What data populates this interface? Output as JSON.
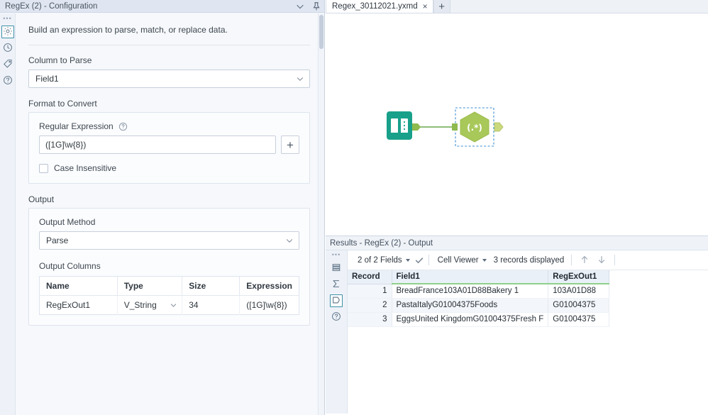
{
  "config_panel": {
    "title": "RegEx (2) - Configuration",
    "titlebar_icons": {
      "collapse": "chevron-down-icon",
      "pin": "pin-icon"
    },
    "rail": [
      {
        "name": "gear-icon",
        "label": "Configuration",
        "active": true
      },
      {
        "name": "runner-icon",
        "label": "Runtime",
        "active": false
      },
      {
        "name": "tag-icon",
        "label": "Annotation",
        "active": false
      },
      {
        "name": "question-icon",
        "label": "Help",
        "active": false
      }
    ],
    "intro": "Build an expression to parse, match, or replace data.",
    "column_to_parse": {
      "label": "Column to Parse",
      "value": "Field1"
    },
    "format_to_convert": {
      "label": "Format to Convert",
      "regular_expression_label": "Regular Expression",
      "regular_expression_value": "([1G]\\w{8})",
      "add_button": "+",
      "case_insensitive_label": "Case Insensitive",
      "case_insensitive_checked": false
    },
    "output": {
      "label": "Output",
      "output_method_label": "Output Method",
      "output_method_value": "Parse",
      "output_columns_label": "Output Columns",
      "columns": [
        "Name",
        "Type",
        "Size",
        "Expression"
      ],
      "rows": [
        {
          "name": "RegExOut1",
          "type": "V_String",
          "size": "34",
          "expression": "([1G]\\w{8})"
        }
      ]
    }
  },
  "workspace": {
    "tab": {
      "label": "Regex_30112021.yxmd",
      "close": "×"
    },
    "new_tab": "+",
    "canvas": {
      "nodes": [
        {
          "name": "input-data-tool",
          "glyph": "book-icon",
          "color": "#21a28c"
        },
        {
          "name": "regex-tool",
          "glyph": "(.*)",
          "color": "#a6c84e",
          "selected": true
        }
      ]
    }
  },
  "results": {
    "header": "Results - RegEx (2) - Output",
    "rail": [
      {
        "name": "grid-icon",
        "active": false
      },
      {
        "name": "sigma-icon",
        "active": false
      },
      {
        "name": "output-anchor-icon",
        "active": true
      },
      {
        "name": "question-icon",
        "active": false
      }
    ],
    "toolbar": {
      "fields_label": "2 of 2 Fields",
      "check_icon": "checkmark-icon",
      "viewer_label": "Cell Viewer",
      "records_label": "3 records displayed",
      "up_icon": "arrow-up-icon",
      "down_icon": "arrow-down-icon"
    },
    "grid": {
      "columns": [
        "Record",
        "Field1",
        "RegExOut1"
      ],
      "rows": [
        {
          "record": "1",
          "field1": "BreadFrance103A01D88Bakery 1",
          "regexout1": "103A01D88"
        },
        {
          "record": "2",
          "field1": "PastaItalyG01004375Foods",
          "regexout1": "G01004375"
        },
        {
          "record": "3",
          "field1": "EggsUnited KingdomG01004375Fresh F",
          "regexout1": "G01004375"
        }
      ]
    }
  },
  "colors": {
    "panel_bg": "#f6f8fb",
    "titlebar": "#dfe6f1",
    "accent_green": "#8ed08a",
    "input_tool": "#21a28c",
    "regex_tool": "#a6c84e",
    "selection_blue": "#3c8fd6"
  }
}
